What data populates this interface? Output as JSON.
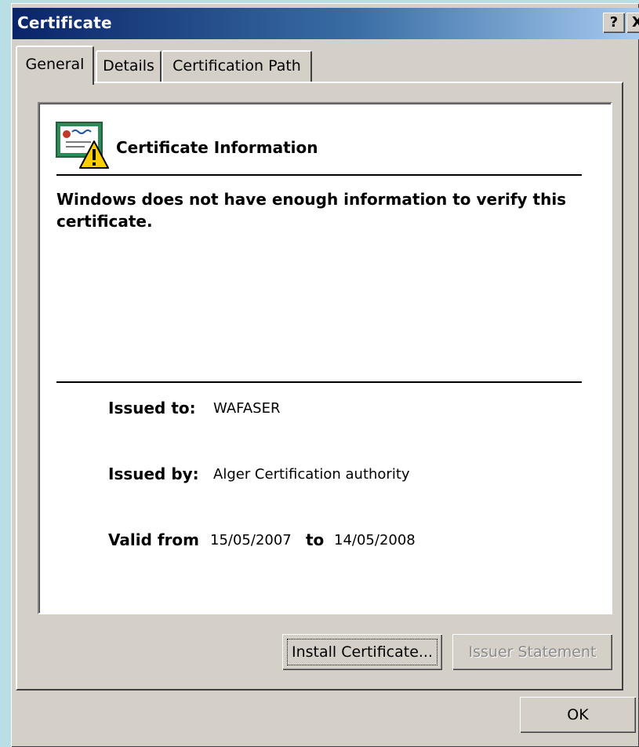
{
  "window": {
    "title": "Certificate",
    "help_label": "?",
    "close_label": "X"
  },
  "tabs": [
    {
      "label": "General",
      "selected": true
    },
    {
      "label": "Details",
      "selected": false
    },
    {
      "label": "Certification Path",
      "selected": false
    }
  ],
  "info": {
    "heading": "Certificate Information",
    "warning": "Windows does not have enough information to verify this certificate.",
    "issued_to_label": "Issued to:",
    "issued_to_value": "WAFASER",
    "issued_by_label": "Issued by:",
    "issued_by_value": "Alger Certification authority",
    "valid_from_label": "Valid from",
    "valid_from_value": "15/05/2007",
    "valid_to_label": "to",
    "valid_to_value": "14/05/2008"
  },
  "buttons": {
    "install": "Install Certificate...",
    "issuer_statement": "Issuer Statement",
    "ok": "OK"
  },
  "icon": "certificate-warning-icon",
  "colors": {
    "titlebar_start": "#0a246a",
    "titlebar_end": "#a6caf0",
    "dialog_face": "#d4d0c8",
    "warning_yellow": "#ffcc00"
  }
}
